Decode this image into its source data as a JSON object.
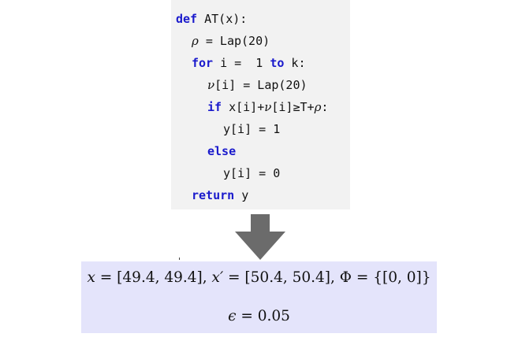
{
  "code": {
    "l1_kw": "def",
    "l1_rest": " AT(x):",
    "l2_var": "ρ",
    "l2_rest": " = Lap(20)",
    "l3_kw_for": "for",
    "l3_mid": " i =  1 ",
    "l3_kw_to": "to",
    "l3_end": " k:",
    "l4_var": "ν",
    "l4_rest": "[i] = Lap(20)",
    "l5_kw": "if",
    "l5_a": " x[i]+",
    "l5_var": "ν",
    "l5_b": "[i]≥T+",
    "l5_rho": "ρ",
    "l5_c": ":",
    "l6_text": "y[i] = 1",
    "l7_kw": "else",
    "l8_text": "y[i] = 0",
    "l9_kw": "return",
    "l9_rest": " y"
  },
  "result": {
    "x_var": "x",
    "x_val": " = [49.4, 49.4], ",
    "xp_var": "x′",
    "xp_val": " = [50.4, 50.4], ",
    "phi_var": "Φ",
    "phi_val": " = {[0, 0]}",
    "eps_var": "ϵ",
    "eps_val": " = 0.05"
  },
  "colors": {
    "code_bg": "#f2f2f2",
    "keyword": "#1a1acc",
    "arrow": "#6b6b6b",
    "result_bg": "#e4e4fb"
  }
}
